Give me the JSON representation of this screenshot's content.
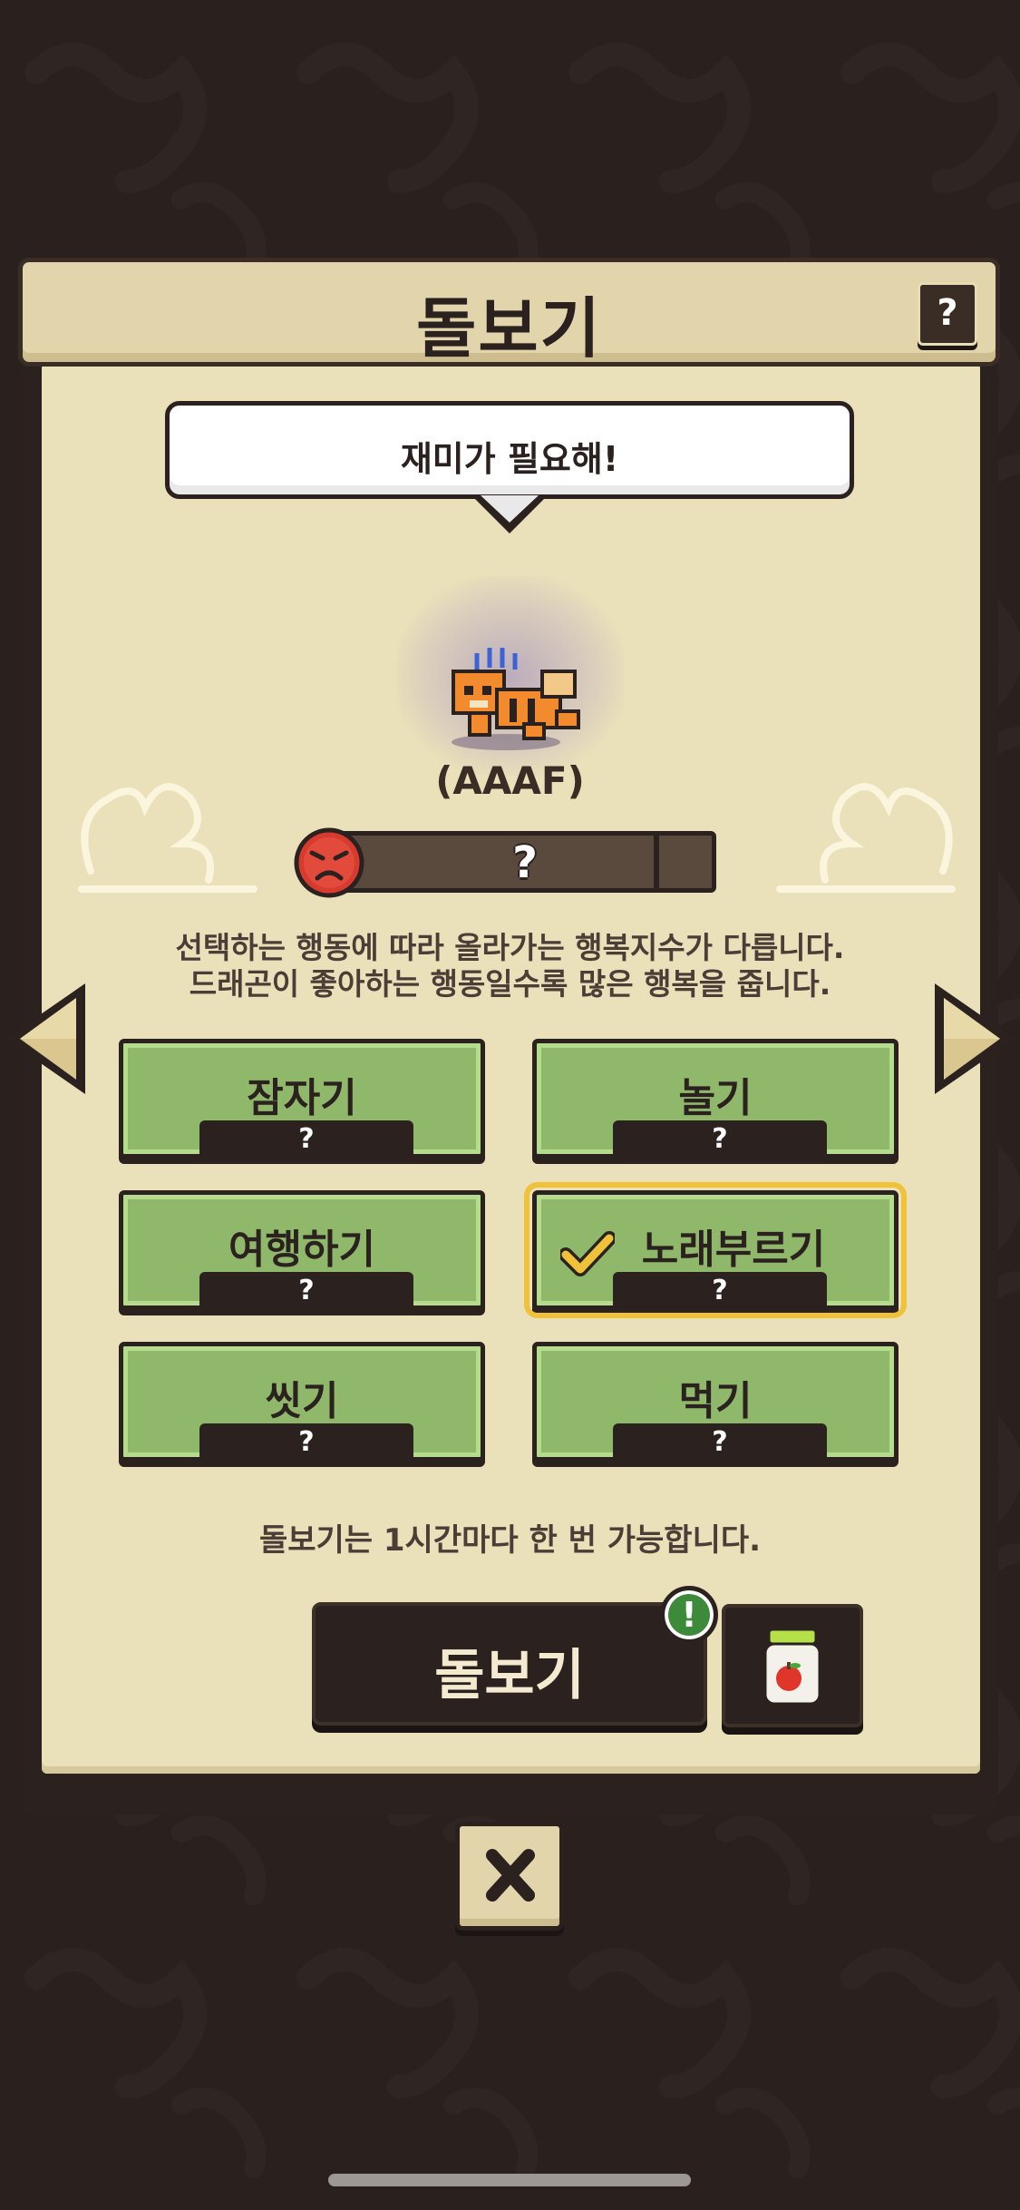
{
  "header": {
    "title": "돌보기",
    "help_label": "?"
  },
  "speech_bubble": "재미가 필요해!",
  "dragon": {
    "name": "(AAAF)",
    "mood": "angry-face-icon"
  },
  "happiness": {
    "value_label": "?",
    "fill_fraction": 0.0
  },
  "description": {
    "line1": "선택하는 행동에 따라 올라가는 행복지수가 다릅니다.",
    "line2": "드래곤이 좋아하는 행동일수록 많은 행복을 줍니다."
  },
  "actions": [
    {
      "label": "잠자기",
      "value": "?"
    },
    {
      "label": "놀기",
      "value": "?"
    },
    {
      "label": "여행하기",
      "value": "?"
    },
    {
      "label": "노래부르기",
      "value": "?",
      "selected": true
    },
    {
      "label": "씻기",
      "value": "?"
    },
    {
      "label": "먹기",
      "value": "?"
    }
  ],
  "note": "돌보기는 1시간마다 한 번 가능합니다.",
  "care_button": {
    "label": "돌보기",
    "badge": "!"
  },
  "colors": {
    "background": "#2a211f",
    "panel": "#eae0b9",
    "action_green": "#8fb86b",
    "selected_outline": "#f0c23a"
  }
}
